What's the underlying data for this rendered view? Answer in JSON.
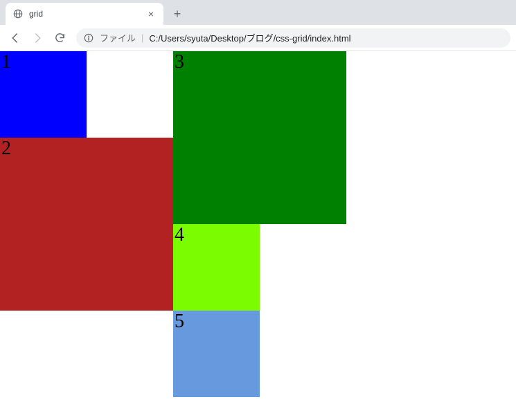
{
  "tab": {
    "title": "grid"
  },
  "address": {
    "prefix": "ファイル",
    "path": "C:/Users/syuta/Desktop/ブログ/css-grid/index.html"
  },
  "grid": {
    "cells": {
      "c1": "1",
      "c2": "2",
      "c3": "3",
      "c4": "4",
      "c5": "5"
    }
  }
}
